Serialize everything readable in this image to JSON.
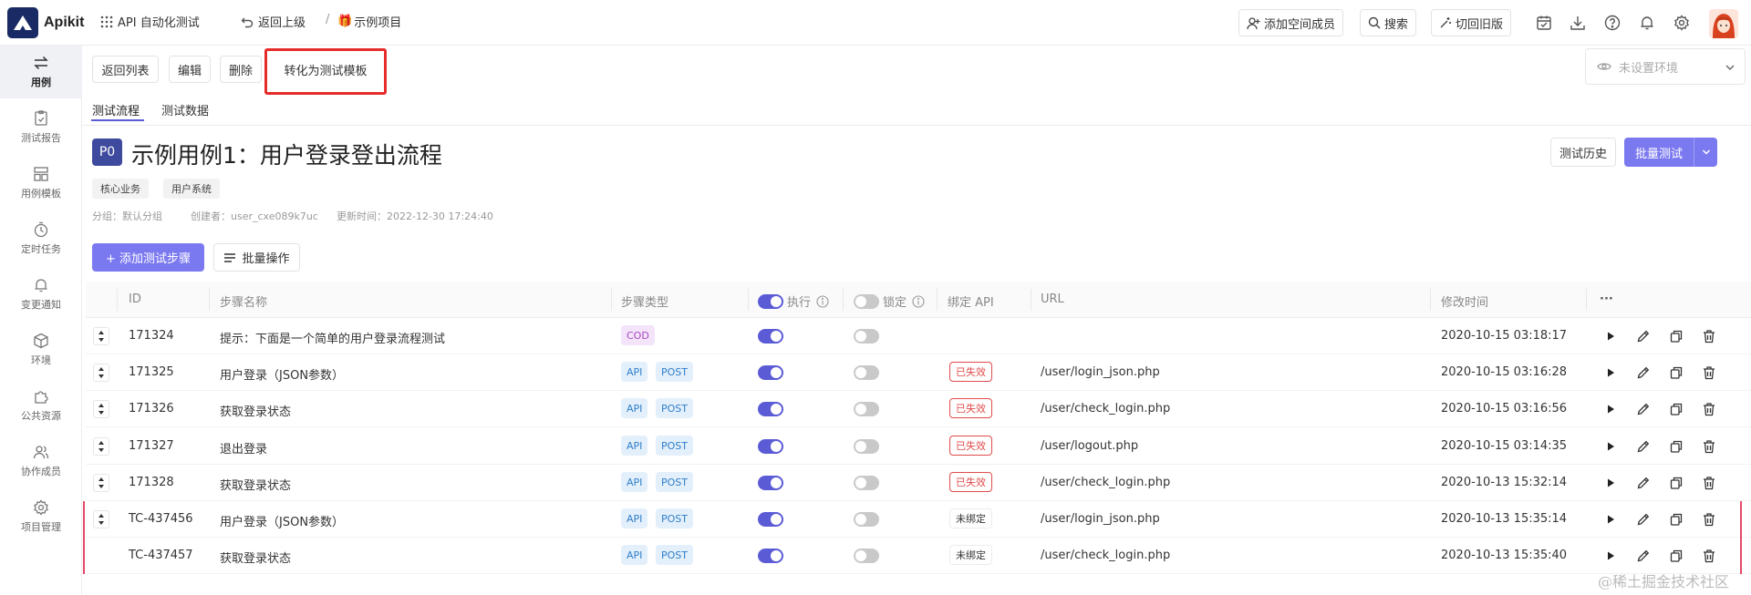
{
  "topbar": {
    "logo_text": "Apikit",
    "module": "API 自动化测试",
    "back": "返回上级",
    "sep": "/",
    "project_icon": "🎁",
    "project": "示例项目",
    "invite": "添加空间成员",
    "search": "搜索",
    "old_version": "切回旧版"
  },
  "sidebar": [
    {
      "label": "用例",
      "icon": "swap-icon"
    },
    {
      "label": "测试报告",
      "icon": "report-icon"
    },
    {
      "label": "用例模板",
      "icon": "template-icon"
    },
    {
      "label": "定时任务",
      "icon": "timer-icon"
    },
    {
      "label": "变更通知",
      "icon": "bell-icon"
    },
    {
      "label": "环境",
      "icon": "cube-icon"
    },
    {
      "label": "公共资源",
      "icon": "puzzle-icon"
    },
    {
      "label": "协作成员",
      "icon": "users-icon"
    },
    {
      "label": "项目管理",
      "icon": "gear-icon"
    }
  ],
  "actions": {
    "back_list": "返回列表",
    "edit": "编辑",
    "delete": "删除",
    "convert": "转化为测试模板"
  },
  "env": {
    "placeholder": "未设置环境"
  },
  "tabs": [
    "测试流程",
    "测试数据"
  ],
  "case": {
    "priority": "P0",
    "title": "示例用例1：用户登录登出流程",
    "tags": [
      "核心业务",
      "用户系统"
    ],
    "group": "分组：默认分组",
    "creator": "创建者：user_cxe089k7uc",
    "updated": "更新时间：2022-12-30 17:24:40",
    "history": "测试历史",
    "batch_test": "批量测试",
    "add_step": "+ 添加测试步骤",
    "bulk_op": "批量操作"
  },
  "table": {
    "headers": {
      "id": "ID",
      "name": "步骤名称",
      "type": "步骤类型",
      "execute": "执行",
      "lock": "锁定",
      "bind": "绑定 API",
      "url": "URL",
      "modified": "修改时间",
      "more": "···"
    },
    "rows": [
      {
        "id": "171324",
        "name": "提示：下面是一个简单的用户登录流程测试",
        "type": [
          "COD"
        ],
        "execute": true,
        "lock": false,
        "bind": "",
        "url": "",
        "modified": "2020-10-15 03:18:17",
        "drag": true,
        "marked": false
      },
      {
        "id": "171325",
        "name": "用户登录（JSON参数）",
        "type": [
          "API",
          "POST"
        ],
        "execute": true,
        "lock": false,
        "bind": "已失效",
        "url": "/user/login_json.php",
        "modified": "2020-10-15 03:16:28",
        "drag": true,
        "marked": false
      },
      {
        "id": "171326",
        "name": "获取登录状态",
        "type": [
          "API",
          "POST"
        ],
        "execute": true,
        "lock": false,
        "bind": "已失效",
        "url": "/user/check_login.php",
        "modified": "2020-10-15 03:16:56",
        "drag": true,
        "marked": false
      },
      {
        "id": "171327",
        "name": "退出登录",
        "type": [
          "API",
          "POST"
        ],
        "execute": true,
        "lock": false,
        "bind": "已失效",
        "url": "/user/logout.php",
        "modified": "2020-10-15 03:14:35",
        "drag": true,
        "marked": false
      },
      {
        "id": "171328",
        "name": "获取登录状态",
        "type": [
          "API",
          "POST"
        ],
        "execute": true,
        "lock": false,
        "bind": "已失效",
        "url": "/user/check_login.php",
        "modified": "2020-10-13 15:32:14",
        "drag": true,
        "marked": false
      },
      {
        "id": "TC-437456",
        "name": "用户登录（JSON参数）",
        "type": [
          "API",
          "POST"
        ],
        "execute": true,
        "lock": false,
        "bind": "未绑定",
        "url": "/user/login_json.php",
        "modified": "2020-10-13 15:35:14",
        "drag": true,
        "marked": true
      },
      {
        "id": "TC-437457",
        "name": "获取登录状态",
        "type": [
          "API",
          "POST"
        ],
        "execute": true,
        "lock": false,
        "bind": "未绑定",
        "url": "/user/check_login.php",
        "modified": "2020-10-13 15:35:40",
        "drag": false,
        "marked": true
      }
    ]
  },
  "watermark": "@稀土掘金技术社区",
  "colors": {
    "accent": "#5b5bd6",
    "primary_button": "#7b79f0",
    "highlight": "#e62b2b",
    "invalid": "#e04a4a"
  }
}
